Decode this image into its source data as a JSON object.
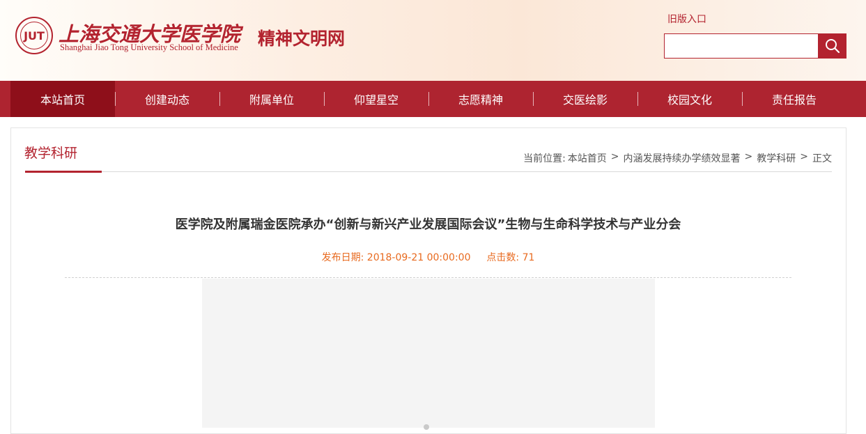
{
  "header": {
    "school_name_cn": "上海交通大学医学院",
    "school_name_en": "Shanghai Jiao Tong University School of Medicine",
    "seal_mark": "JUT",
    "site_title": "精神文明网",
    "old_version_link": "旧版入口",
    "search_placeholder": "",
    "brand_color": "#ae2430"
  },
  "nav": {
    "items": [
      {
        "label": "本站首页"
      },
      {
        "label": "创建动态"
      },
      {
        "label": "附属单位"
      },
      {
        "label": "仰望星空"
      },
      {
        "label": "志愿精神"
      },
      {
        "label": "交医绘影"
      },
      {
        "label": "校园文化"
      },
      {
        "label": "责任报告"
      }
    ],
    "active_index": 0
  },
  "section": {
    "title": "教学科研"
  },
  "breadcrumb": {
    "prefix": "当前位置:",
    "items": [
      "本站首页",
      "内涵发展持续办学绩效显著",
      "教学科研",
      "正文"
    ],
    "separator": ">"
  },
  "article": {
    "title": "医学院及附属瑞金医院承办“创新与新兴产业发展国际会议”生物与生命科学技术与产业分会",
    "date_label": "发布日期:",
    "date_value": "2018-09-21 00:00:00",
    "views_label": "点击数:",
    "views_value": "71",
    "meta_color": "#e86a1f"
  }
}
